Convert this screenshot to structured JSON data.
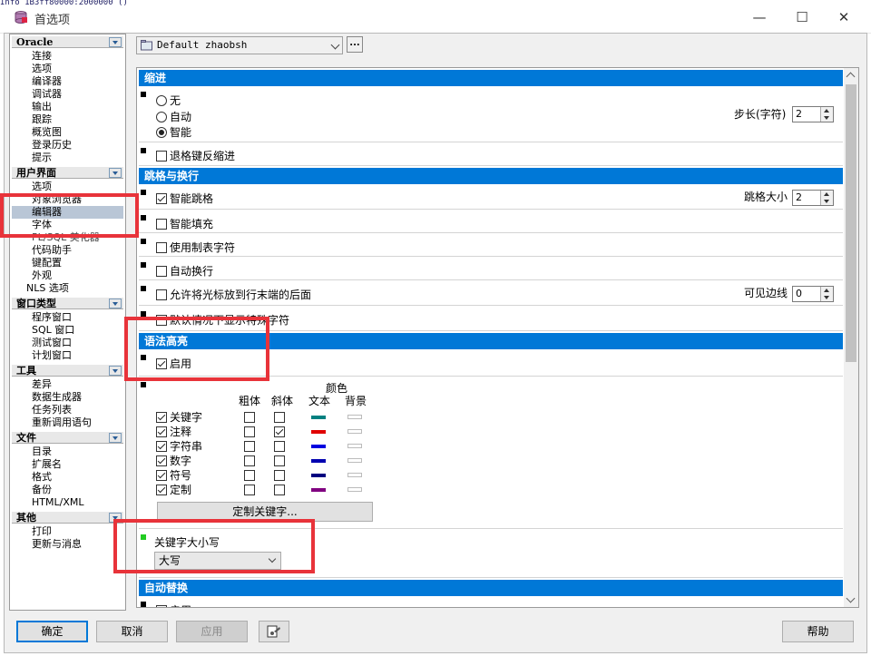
{
  "window": {
    "top_text": "Info 1B3ff80000:2000000 ()",
    "title": "首选项",
    "minimize": "—",
    "maximize": "☐",
    "close": "✕"
  },
  "nav": {
    "groups": [
      {
        "name": "Oracle",
        "items": [
          "连接",
          "选项",
          "编译器",
          "调试器",
          "输出",
          "跟踪",
          "概览图",
          "登录历史",
          "提示"
        ]
      },
      {
        "name": "用户界面",
        "items": [
          "选项",
          "对象浏览器",
          "编辑器",
          "字体",
          "代码助手",
          "键配置",
          "外观",
          "NLS 选项"
        ]
      },
      {
        "name": "窗口类型",
        "items": [
          "程序窗口",
          "SQL 窗口",
          "测试窗口",
          "计划窗口"
        ]
      },
      {
        "name": "工具",
        "items": [
          "差异",
          "数据生成器",
          "任务列表",
          "重新调用语句"
        ]
      },
      {
        "name": "文件",
        "items": [
          "目录",
          "扩展名",
          "格式",
          "备份",
          "HTML/XML"
        ]
      },
      {
        "name": "其他",
        "items": [
          "打印",
          "更新与消息"
        ]
      }
    ],
    "overlap_text": "PL/SQL 美化器"
  },
  "profile": {
    "value": "Default zhaobsh",
    "more": "..."
  },
  "sections": {
    "indent": {
      "title": "缩进",
      "options": [
        "无",
        "自动",
        "智能"
      ],
      "selected": "智能",
      "step_label": "步长(字符)",
      "step_value": "2",
      "backspace_unindent": "退格键反缩进"
    },
    "tabs": {
      "title": "跳格与换行",
      "smart_tab": "智能跳格",
      "tab_size_label": "跳格大小",
      "tab_size_value": "2",
      "smart_fill": "智能填充",
      "use_tab_char": "使用制表字符",
      "word_wrap": "自动换行",
      "cursor_beyond_eol": "允许将光标放到行末端的后面",
      "visible_margin_label": "可见边线",
      "visible_margin_value": "0",
      "default_show_special": "默认情况下显示特殊字符"
    },
    "syntax": {
      "title": "语法高亮",
      "enable": "启用",
      "col_bold": "粗体",
      "col_italic": "斜体",
      "col_color": "颜色",
      "col_text": "文本",
      "col_bg": "背景",
      "rows": [
        {
          "label": "关键字",
          "bold": false,
          "italic": false,
          "text_color": "#008080"
        },
        {
          "label": "注释",
          "bold": false,
          "italic": true,
          "text_color": "#e00000"
        },
        {
          "label": "字符串",
          "bold": false,
          "italic": false,
          "text_color": "#0000e0"
        },
        {
          "label": "数字",
          "bold": false,
          "italic": false,
          "text_color": "#0000b0"
        },
        {
          "label": "符号",
          "bold": false,
          "italic": false,
          "text_color": "#000080"
        },
        {
          "label": "定制",
          "bold": false,
          "italic": false,
          "text_color": "#800080"
        }
      ],
      "custom_keywords_btn": "定制关键字..."
    },
    "keyword_case": {
      "label": "关键字大小写",
      "value": "大写"
    },
    "autoreplace": {
      "title": "自动替换",
      "enable": "启用"
    }
  },
  "buttons": {
    "ok": "确定",
    "cancel": "取消",
    "apply": "应用",
    "help": "帮助"
  }
}
